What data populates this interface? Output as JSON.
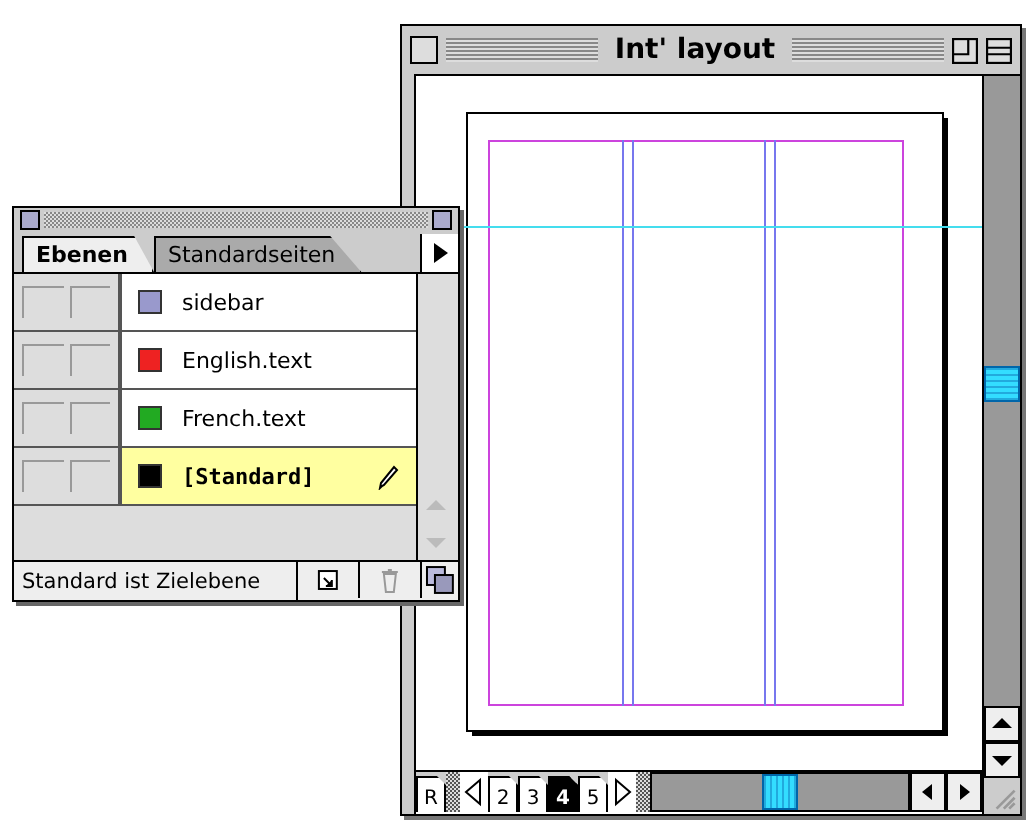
{
  "document_window": {
    "title": "Int' layout",
    "pages": [
      {
        "label": "R",
        "selected": false
      },
      {
        "label": "2",
        "selected": false
      },
      {
        "label": "3",
        "selected": false
      },
      {
        "label": "4",
        "selected": true
      },
      {
        "label": "5",
        "selected": false
      }
    ]
  },
  "layers_palette": {
    "tabs": [
      {
        "label": "Ebenen",
        "selected": true
      },
      {
        "label": "Standardseiten",
        "selected": false
      }
    ],
    "layers": [
      {
        "name": "sidebar",
        "color": "#9999cc",
        "selected": false,
        "target": false
      },
      {
        "name": "English.text",
        "color": "#ee2222",
        "selected": false,
        "target": false
      },
      {
        "name": "French.text",
        "color": "#22aa22",
        "selected": false,
        "target": false
      },
      {
        "name": "[Standard]",
        "color": "#000000",
        "selected": true,
        "target": true
      }
    ],
    "status": "Standard ist Zielebene"
  }
}
